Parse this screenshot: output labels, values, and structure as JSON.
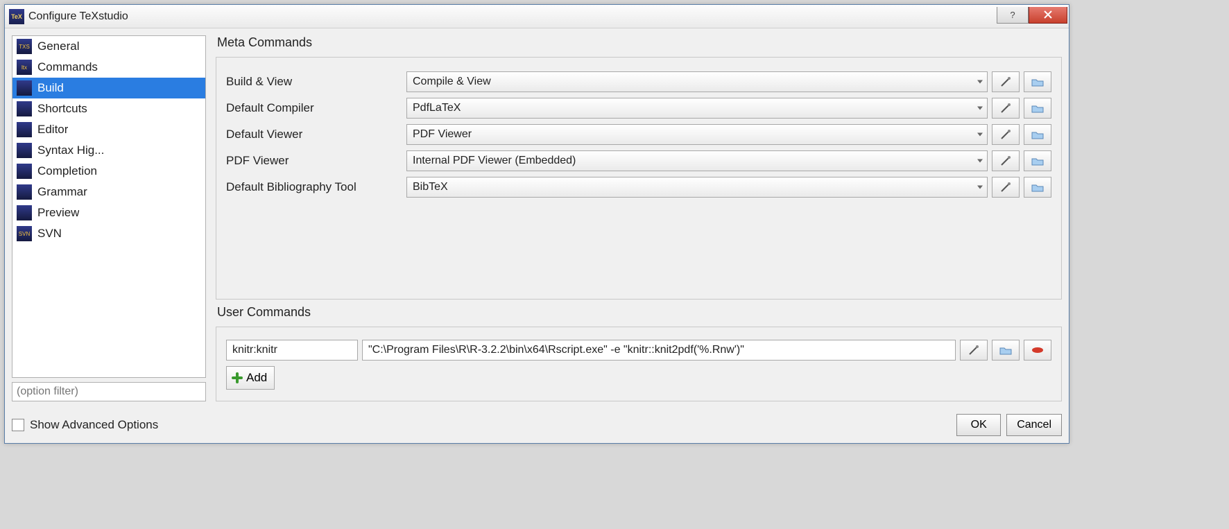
{
  "window": {
    "title": "Configure TeXstudio"
  },
  "sidebar": {
    "items": [
      {
        "label": "General"
      },
      {
        "label": "Commands"
      },
      {
        "label": "Build"
      },
      {
        "label": "Shortcuts"
      },
      {
        "label": "Editor"
      },
      {
        "label": "Syntax Hig..."
      },
      {
        "label": "Completion"
      },
      {
        "label": "Grammar"
      },
      {
        "label": "Preview"
      },
      {
        "label": "SVN"
      }
    ],
    "selected_index": 2,
    "filter_placeholder": "(option filter)"
  },
  "meta": {
    "group_title": "Meta Commands",
    "rows": [
      {
        "label": "Build & View",
        "value": "Compile & View"
      },
      {
        "label": "Default Compiler",
        "value": "PdfLaTeX"
      },
      {
        "label": "Default Viewer",
        "value": "PDF Viewer"
      },
      {
        "label": "PDF Viewer",
        "value": "Internal PDF Viewer (Embedded)"
      },
      {
        "label": "Default Bibliography Tool",
        "value": "BibTeX"
      }
    ]
  },
  "user": {
    "group_title": "User Commands",
    "rows": [
      {
        "name": "knitr:knitr",
        "command": "\"C:\\Program Files\\R\\R-3.2.2\\bin\\x64\\Rscript.exe\" -e \"knitr::knit2pdf('%.Rnw')\""
      }
    ],
    "add_label": "Add"
  },
  "bottom": {
    "advanced_label": "Show Advanced Options",
    "ok_label": "OK",
    "cancel_label": "Cancel"
  }
}
